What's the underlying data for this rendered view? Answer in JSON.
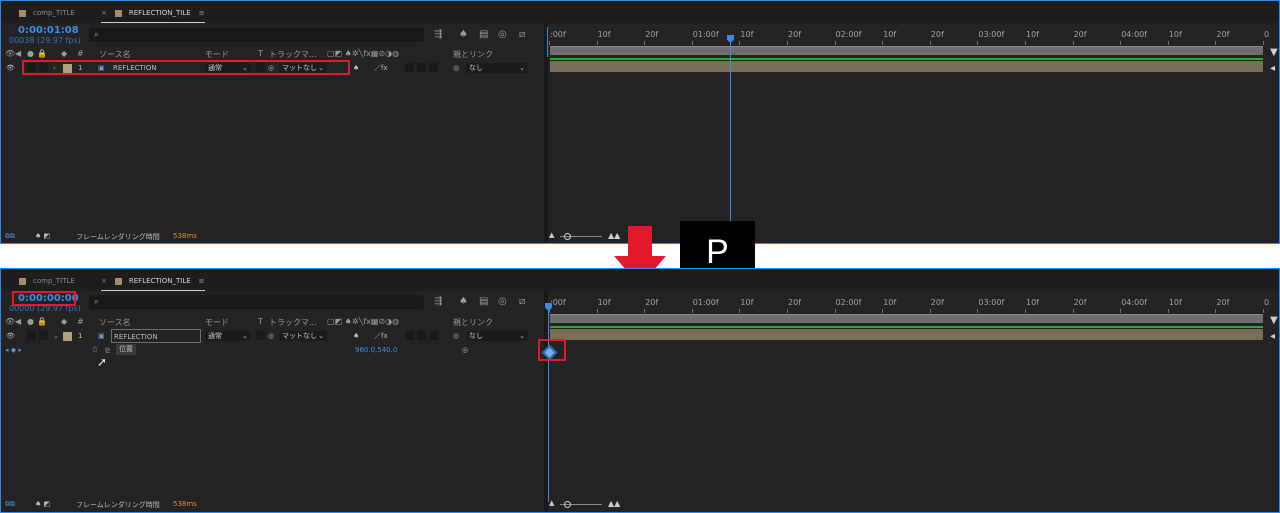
{
  "top": {
    "tabs": [
      {
        "label": "comp_TITLE"
      },
      {
        "label": "REFLECTION_TILE",
        "close": "×",
        "menu": "≡"
      }
    ],
    "timecode": "0:00:01:08",
    "fps": "00038 (29.97 fps)",
    "search": {
      "icon": "search-icon",
      "value": ""
    },
    "headers": {
      "num": "#",
      "source": "ソース名",
      "mode": "モード",
      "t": "T",
      "track": "トラックマ...",
      "parent": "親とリンク"
    },
    "layer": {
      "number": "1",
      "name": "REFLECTION",
      "mode": "通常",
      "track": "マットなし",
      "parent": "なし"
    },
    "status": {
      "label": "フレームレンダリング時間",
      "value": "538ms"
    }
  },
  "bottom": {
    "tabs": [
      {
        "label": "comp_TITLE"
      },
      {
        "label": "REFLECTION_TILE",
        "close": "×",
        "menu": "≡"
      }
    ],
    "timecode": "0:00:00:00",
    "fps": "00000 (29.97 fps)",
    "search": {
      "icon": "search-icon",
      "value": ""
    },
    "headers": {
      "num": "#",
      "source": "ソース名",
      "mode": "モード",
      "t": "T",
      "track": "トラックマ...",
      "parent": "親とリンク"
    },
    "layer": {
      "number": "1",
      "name": "REFLECTION",
      "mode": "通常",
      "track": "マットなし",
      "parent": "なし"
    },
    "property": {
      "name": "位置",
      "value": "960.0,540.0"
    },
    "status": {
      "label": "フレームレンダリング時間",
      "value": "538ms"
    }
  },
  "ruler": {
    "ticks": [
      ":00f",
      "10f",
      "20f",
      "01:00f",
      "10f",
      "20f",
      "02:00f",
      "10f",
      "20f",
      "03:00f",
      "10f",
      "20f",
      "04:00f",
      "10f",
      "20f",
      "05:0"
    ]
  },
  "overlay": {
    "key_label": "P"
  },
  "colors": {
    "timecode": "#3d8ee9",
    "highlight": "#e5192c",
    "accent": "#2d8ceb",
    "green_bar": "#1fae2f",
    "layer_bar": "#7b6e59"
  }
}
